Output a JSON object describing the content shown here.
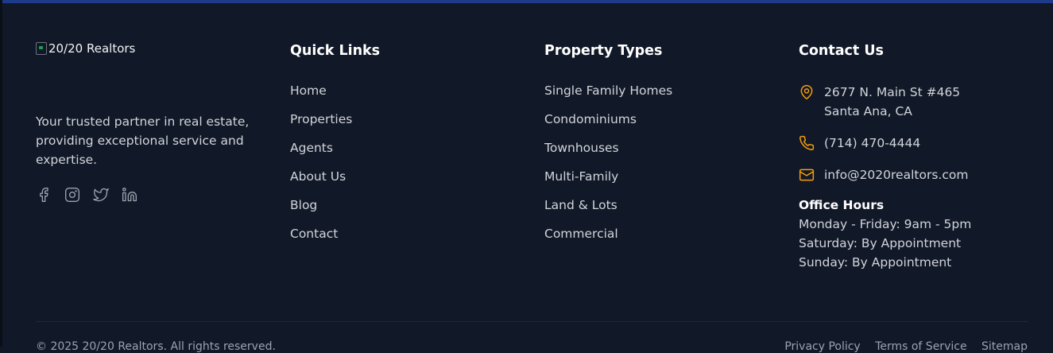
{
  "brand": {
    "logo_alt": "20/20 Realtors",
    "tagline": "Your trusted partner in real estate, providing exceptional service and expertise."
  },
  "social": [
    "facebook-icon",
    "instagram-icon",
    "twitter-icon",
    "linkedin-icon"
  ],
  "quick_links": {
    "title": "Quick Links",
    "items": [
      "Home",
      "Properties",
      "Agents",
      "About Us",
      "Blog",
      "Contact"
    ]
  },
  "property_types": {
    "title": "Property Types",
    "items": [
      "Single Family Homes",
      "Condominiums",
      "Townhouses",
      "Multi-Family",
      "Land & Lots",
      "Commercial"
    ]
  },
  "contact": {
    "title": "Contact Us",
    "address_line1": "2677 N. Main St #465",
    "address_line2": "Santa Ana, CA",
    "phone": "(714) 470-4444",
    "email": "info@2020realtors.com",
    "office_hours_title": "Office Hours",
    "hours": [
      "Monday - Friday: 9am - 5pm",
      "Saturday: By Appointment",
      "Sunday: By Appointment"
    ]
  },
  "footer": {
    "copyright": "© 2025 20/20 Realtors. All rights reserved.",
    "links": [
      "Privacy Policy",
      "Terms of Service",
      "Sitemap"
    ]
  },
  "colors": {
    "background": "#111827",
    "accent": "#f59e0b",
    "top_bar": "#1e3a8a"
  }
}
